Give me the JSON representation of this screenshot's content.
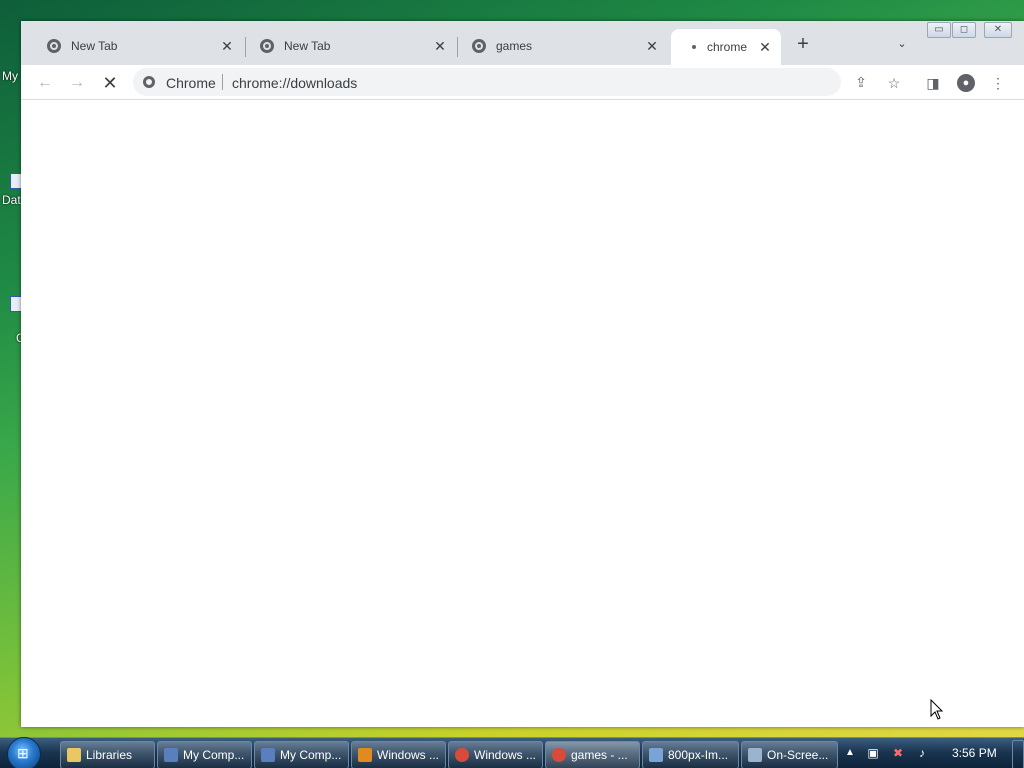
{
  "desktop": {
    "icon_labels": [
      "My",
      "Dat",
      "C"
    ]
  },
  "browser": {
    "tabs": [
      {
        "label": "New Tab",
        "icon": "chrome-icon"
      },
      {
        "label": "New Tab",
        "icon": "chrome-icon"
      },
      {
        "label": "games",
        "icon": "chrome-icon"
      },
      {
        "label": "chrome:",
        "icon": "loading-spinner-icon",
        "active": true
      }
    ],
    "close_glyph": "✕",
    "new_tab_glyph": "+",
    "tab_search_glyph": "⌄",
    "window_controls": {
      "minimize": "▭",
      "maximize": "◻",
      "close": "✕"
    },
    "toolbar": {
      "back_glyph": "←",
      "forward_glyph": "→",
      "stop_glyph": "✕",
      "chip_label": "Chrome",
      "url": "chrome://downloads",
      "share_glyph": "⇪",
      "bookmark_glyph": "☆",
      "sidepanel_glyph": "◨",
      "profile_glyph": "●",
      "menu_glyph": "⋮"
    }
  },
  "taskbar": {
    "start_glyph": "⊞",
    "buttons": [
      {
        "label": "Libraries",
        "icon": "folder-icon",
        "color": "#e8c860"
      },
      {
        "label": "My Comp...",
        "icon": "computer-icon",
        "color": "#5a7fbf"
      },
      {
        "label": "My Comp...",
        "icon": "computer-icon",
        "color": "#5a7fbf"
      },
      {
        "label": "Windows ...",
        "icon": "media-player-icon",
        "color": "#e08a20"
      },
      {
        "label": "Windows ...",
        "icon": "chrome-icon",
        "color": "#d84a3a"
      },
      {
        "label": "games - ...",
        "icon": "chrome-icon",
        "color": "#d84a3a"
      },
      {
        "label": "800px-Im...",
        "icon": "image-viewer-icon",
        "color": "#7aa4d8"
      },
      {
        "label": "On-Scree...",
        "icon": "keyboard-icon",
        "color": "#9ab4d0"
      }
    ],
    "tray_arrow": "▲",
    "clock": "3:56 PM"
  }
}
